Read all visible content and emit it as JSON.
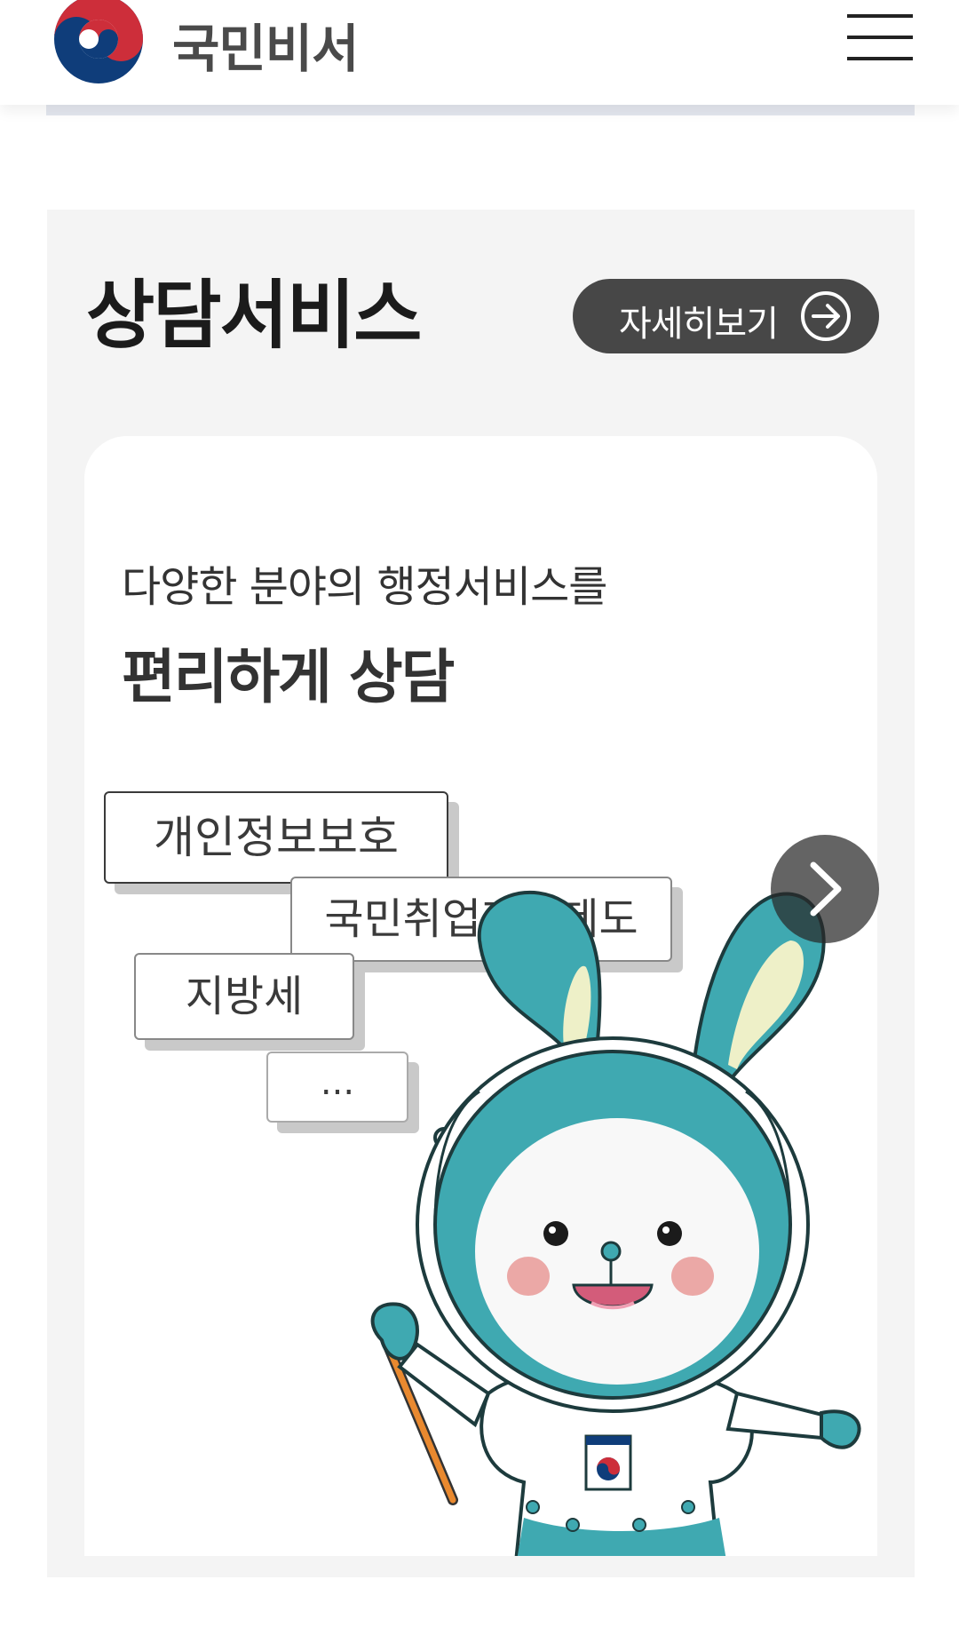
{
  "header": {
    "brand": "국민비서",
    "logo_icon": "korea-government-taegeuk-icon",
    "menu_icon": "hamburger-menu-icon"
  },
  "section": {
    "title": "상담서비스",
    "more_button_label": "자세히보기",
    "more_button_icon": "arrow-right-circle-icon"
  },
  "card": {
    "subtitle": "다양한 분야의 행정서비스를",
    "headline": "편리하게 상담",
    "chips": [
      "개인정보보호",
      "국민취업지원제도",
      "지방세",
      "..."
    ],
    "next_icon": "chevron-right-icon"
  },
  "colors": {
    "header_bg": "#ffffff",
    "panel_bg": "#f4f4f4",
    "button_bg": "#474747",
    "mascot_teal": "#3fa9b1",
    "logo_red": "#cd2e3a",
    "logo_blue": "#0f3d7a"
  }
}
